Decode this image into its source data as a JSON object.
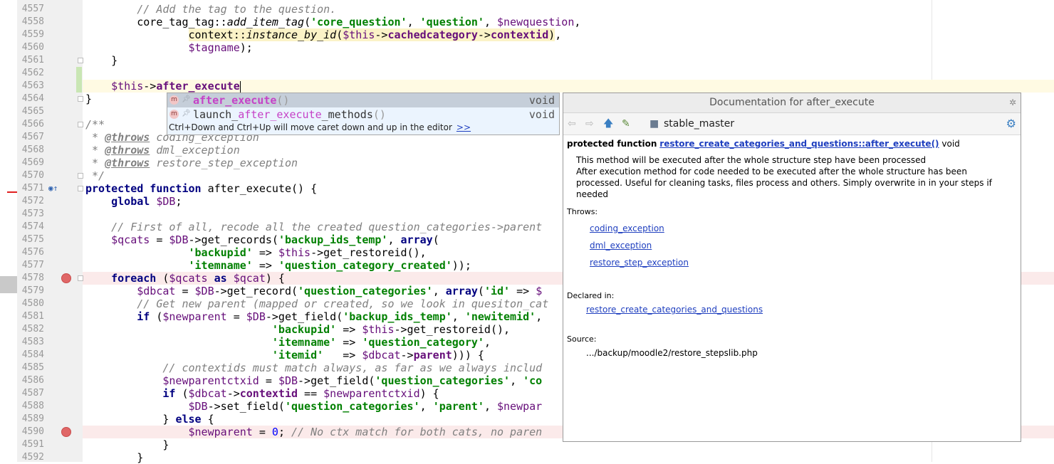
{
  "editor": {
    "lines": [
      {
        "n": "4557",
        "html": "        <span class=\"cmt\">// Add the tag to the question.</span>"
      },
      {
        "n": "4558",
        "html": "        core_tag_tag::<span class=\"st\">add_item_tag</span>(<span class=\"str\">'core_question'</span>, <span class=\"str\">'question'</span>, <span class=\"var\">$newquestion</span>,"
      },
      {
        "n": "4559",
        "html": "                <span class=\"hl\">context::<span class=\"st\">instance_by_id</span>(<span class=\"var\">$this</span>-><span class=\"prop\">cachedcategory</span>-><span class=\"prop\">contextid</span>)</span>,"
      },
      {
        "n": "4560",
        "html": "                <span class=\"var\">$tagname</span>);"
      },
      {
        "n": "4561",
        "html": "    }"
      },
      {
        "n": "4562",
        "html": ""
      },
      {
        "n": "4563",
        "html": "    <span class=\"var\">$this</span>-><span class=\"prop\">after_execute</span><span class=\"caret\"></span>"
      },
      {
        "n": "4564",
        "html": "}"
      },
      {
        "n": "4565",
        "html": ""
      },
      {
        "n": "4566",
        "html": "<span class=\"cmt\">/**</span>"
      },
      {
        "n": "4567",
        "html": "<span class=\"cmt\"> * <span class=\"tag\">@throws</span> coding_exception</span>"
      },
      {
        "n": "4568",
        "html": "<span class=\"cmt\"> * <span class=\"tag\">@throws</span> dml_exception</span>"
      },
      {
        "n": "4569",
        "html": "<span class=\"cmt\"> * <span class=\"tag\">@throws</span> restore_step_exception</span>"
      },
      {
        "n": "4570",
        "html": "<span class=\"cmt\"> */</span>"
      },
      {
        "n": "4571",
        "html": "<span class=\"kw\">protected function</span> after_execute() {"
      },
      {
        "n": "4572",
        "html": "    <span class=\"kw\">global</span> <span class=\"var\">$DB</span>;"
      },
      {
        "n": "4573",
        "html": ""
      },
      {
        "n": "4574",
        "html": "    <span class=\"cmt\">// First of all, recode all the created question_categories->parent</span>"
      },
      {
        "n": "4575",
        "html": "    <span class=\"var\">$qcats</span> = <span class=\"var\">$DB</span>->get_records(<span class=\"str\">'backup_ids_temp'</span>, <span class=\"kw\">array</span>("
      },
      {
        "n": "4576",
        "html": "                <span class=\"str\">'backupid'</span> => <span class=\"var\">$this</span>->get_restoreid(),"
      },
      {
        "n": "4577",
        "html": "                <span class=\"str\">'itemname'</span> => <span class=\"str\">'question_category_created'</span>));"
      },
      {
        "n": "4578",
        "html": "    <span class=\"kw\">foreach</span> (<span class=\"var\">$qcats</span> <span class=\"kw\">as</span> <span class=\"var\">$qcat</span>) {"
      },
      {
        "n": "4579",
        "html": "        <span class=\"var\">$dbcat</span> = <span class=\"var\">$DB</span>->get_record(<span class=\"str\">'question_categories'</span>, <span class=\"kw\">array</span>(<span class=\"str\">'id'</span> => <span class=\"var\">$</span>"
      },
      {
        "n": "4580",
        "html": "        <span class=\"cmt\">// Get new parent (mapped or created, so we look in quesiton_cat</span>"
      },
      {
        "n": "4581",
        "html": "        <span class=\"kw\">if</span> (<span class=\"var\">$newparent</span> = <span class=\"var\">$DB</span>->get_field(<span class=\"str\">'backup_ids_temp'</span>, <span class=\"str\">'newitemid'</span>,"
      },
      {
        "n": "4582",
        "html": "                             <span class=\"str\">'backupid'</span> => <span class=\"var\">$this</span>->get_restoreid(),"
      },
      {
        "n": "4583",
        "html": "                             <span class=\"str\">'itemname'</span> => <span class=\"str\">'question_category'</span>,"
      },
      {
        "n": "4584",
        "html": "                             <span class=\"str\">'itemid'</span>   => <span class=\"var\">$dbcat</span>-><span class=\"prop\">parent</span>))) {"
      },
      {
        "n": "4585",
        "html": "            <span class=\"cmt\">// contextids must match always, as far as we always includ</span>"
      },
      {
        "n": "4586",
        "html": "            <span class=\"var\">$newparentctxid</span> = <span class=\"var\">$DB</span>->get_field(<span class=\"str\">'question_categories'</span>, <span class=\"str\">'co</span>"
      },
      {
        "n": "4587",
        "html": "            <span class=\"kw\">if</span> (<span class=\"var\">$dbcat</span>-><span class=\"prop\">contextid</span> == <span class=\"var\">$newparentctxid</span>) {"
      },
      {
        "n": "4588",
        "html": "                <span class=\"var\">$DB</span>->set_field(<span class=\"str\">'question_categories'</span>, <span class=\"str\">'parent'</span>, <span class=\"var\">$newpar</span>"
      },
      {
        "n": "4589",
        "html": "            } <span class=\"kw\">else</span> {"
      },
      {
        "n": "4590",
        "html": "                <span class=\"var\">$newparent</span> = <span class=\"num\">0</span>; <span class=\"cmt\">// No ctx match for both cats, no paren</span>"
      },
      {
        "n": "4591",
        "html": "            }"
      },
      {
        "n": "4592",
        "html": "        }"
      }
    ]
  },
  "completion": {
    "items": [
      {
        "match": "after_execute",
        "prefix": "",
        "suffix": "",
        "paren": "()",
        "type": "void",
        "badge": "m"
      },
      {
        "match": "after_execute",
        "prefix": "launch_",
        "suffix": "_methods",
        "paren": "()",
        "type": "void",
        "badge": "m"
      }
    ],
    "hint": "Ctrl+Down and Ctrl+Up will move caret down and up in the editor",
    "hint_link": ">>"
  },
  "doc": {
    "title": "Documentation for after_execute",
    "branch": "stable_master",
    "sig_prefix": "protected function",
    "sig_link": "restore_create_categories_and_questions::after_execute()",
    "sig_suffix": "void",
    "desc1": "This method will be executed after the whole structure step have been processed",
    "desc2": "After execution method for code needed to be executed after the whole structure has been processed. Useful for cleaning tasks, files process and others. Simply overwrite in in your steps if needed",
    "throws_label": "Throws:",
    "throws": [
      "coding_exception",
      "dml_exception",
      "restore_step_exception"
    ],
    "declared_label": "Declared in:",
    "declared": "restore_create_categories_and_questions",
    "source_label": "Source:",
    "source": ".../backup/moodle2/restore_stepslib.php",
    "icons": {
      "back": "back-arrow-icon",
      "forward": "forward-arrow-icon",
      "up": "up-arrow-icon",
      "edit": "edit-source-icon",
      "folder": "folder-icon",
      "gear": "gear-icon",
      "pin": "pin-icon"
    }
  }
}
